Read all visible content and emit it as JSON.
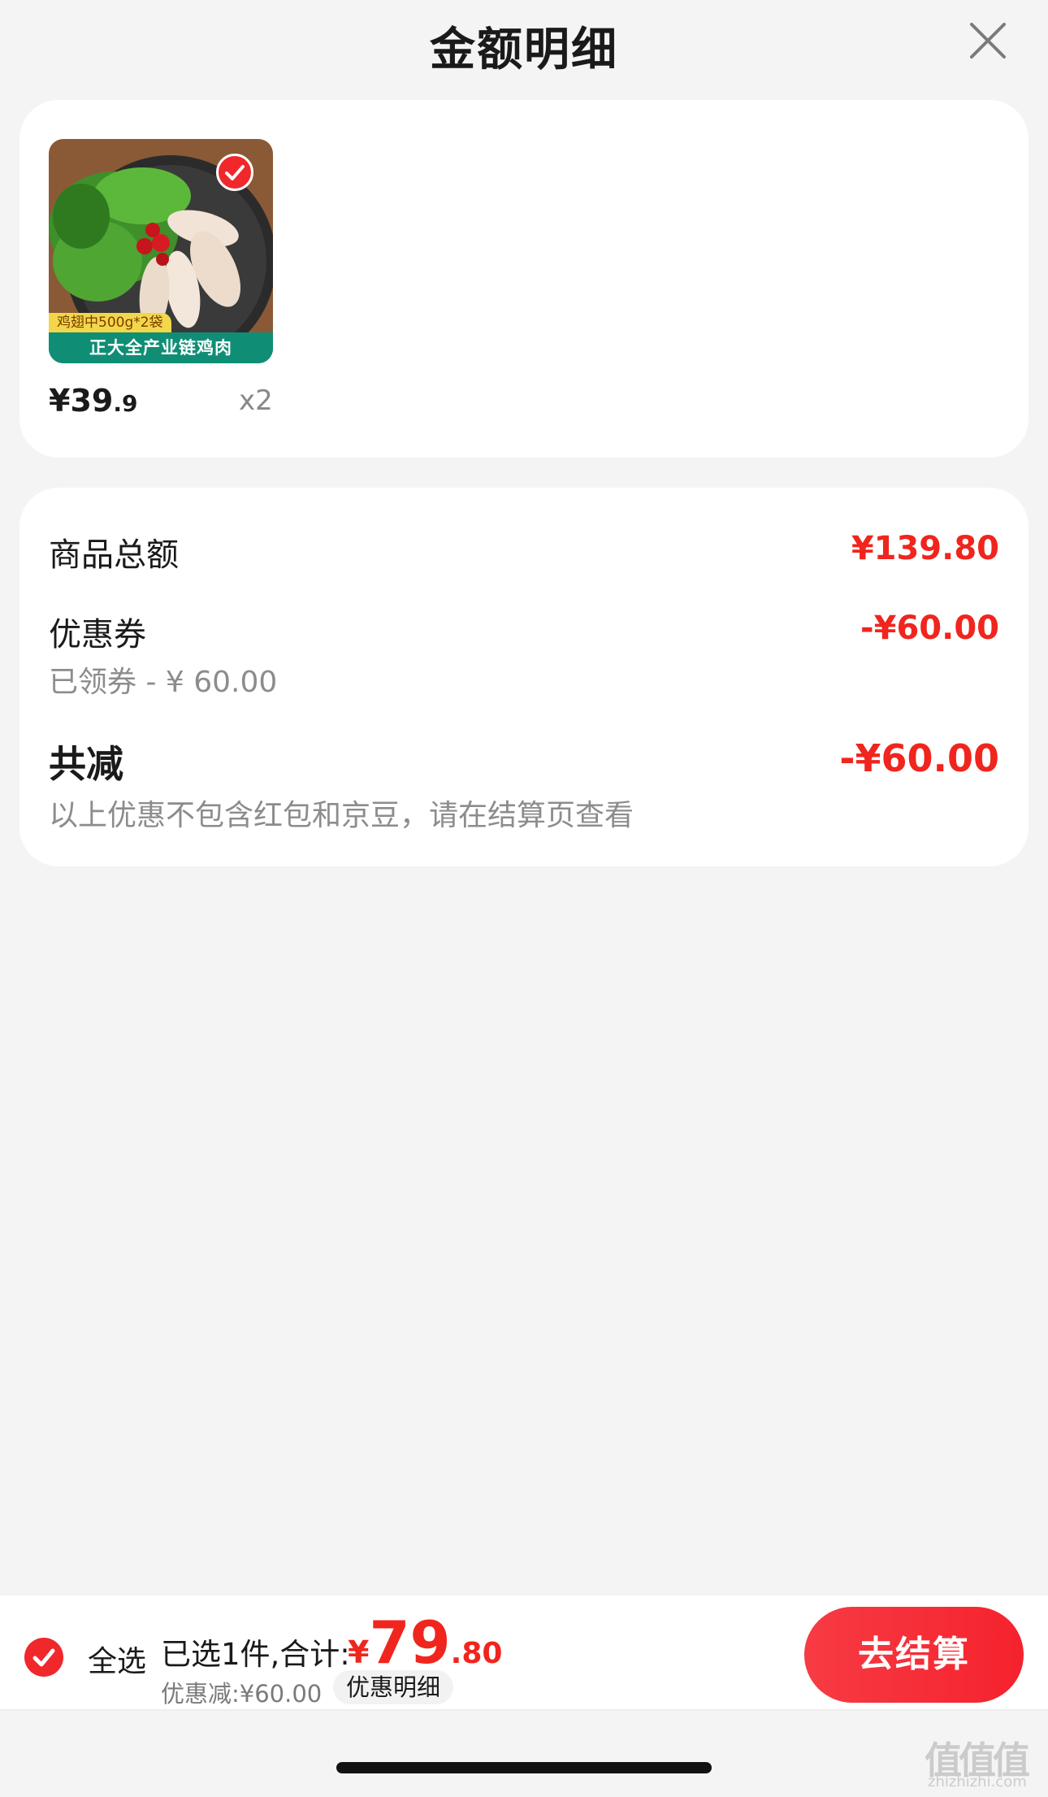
{
  "header": {
    "title": "金额明细",
    "close_icon": "close-icon"
  },
  "product": {
    "image_badge_top": "鸡翅中500g*2袋",
    "image_badge_bottom": "正大全产业链鸡肉",
    "selected_icon": "check-icon",
    "price_yen": "¥",
    "price_int": "39",
    "price_dec": ".9",
    "quantity": "x2"
  },
  "summary": {
    "goods_total_label": "商品总额",
    "goods_total_value": "¥139.80",
    "coupon_label": "优惠券",
    "coupon_sub": "已领券 - ¥ 60.00",
    "coupon_value": "-¥60.00",
    "total_discount_label": "共减",
    "total_discount_value": "-¥60.00",
    "note": "以上优惠不包含红包和京豆，请在结算页查看"
  },
  "bottom_bar": {
    "select_all_label": "全选",
    "selected_text": "已选1件,合计:",
    "total_yen": "¥",
    "total_int": "79",
    "total_dec": ".80",
    "discount_text": "优惠减:¥60.00",
    "detail_label": "优惠明细",
    "checkout_label": "去结算"
  },
  "watermark": {
    "main": "值值值",
    "sub": "zhizhizhi.com"
  },
  "colors": {
    "accent_red": "#f0251e",
    "background": "#f4f4f4",
    "card": "#ffffff"
  }
}
